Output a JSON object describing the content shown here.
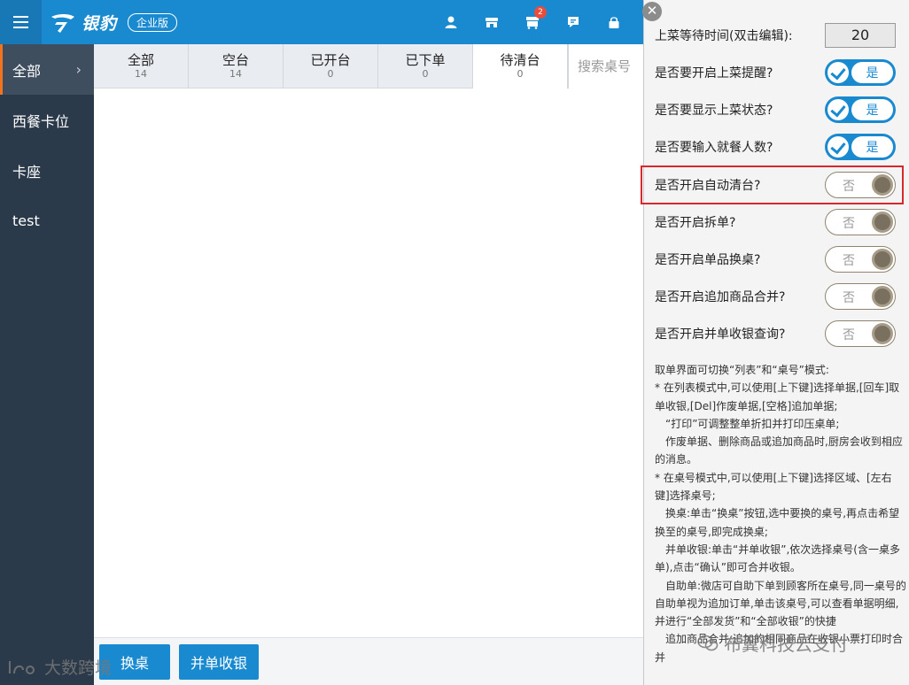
{
  "topbar": {
    "brand": "银豹",
    "edition": "企业版",
    "icons": [
      "user-icon",
      "store-icon",
      "cart-icon",
      "message-icon",
      "lock-icon"
    ],
    "cart_badge": "2"
  },
  "sidebar": {
    "items": [
      {
        "label": "全部"
      },
      {
        "label": "西餐卡位"
      },
      {
        "label": "卡座"
      },
      {
        "label": "test"
      }
    ],
    "active_chevron": "›"
  },
  "tabs": [
    {
      "label": "全部",
      "count": "14"
    },
    {
      "label": "空台",
      "count": "14"
    },
    {
      "label": "已开台",
      "count": "0"
    },
    {
      "label": "已下单",
      "count": "0"
    },
    {
      "label": "待清台",
      "count": "0"
    }
  ],
  "search": {
    "placeholder": "搜索桌号"
  },
  "bottom": {
    "swap_label": "换桌",
    "merge_label": "并单收银"
  },
  "watermarks": {
    "left": "大数跨境",
    "right": "布翼科技云支付"
  },
  "settings": {
    "close": "✕",
    "wait_label": "上菜等待时间(双击编辑):",
    "wait_value": "20",
    "toggles": [
      {
        "label": "是否要开启上菜提醒?",
        "text": "是",
        "state": "on"
      },
      {
        "label": "是否要显示上菜状态?",
        "text": "是",
        "state": "on"
      },
      {
        "label": "是否要输入就餐人数?",
        "text": "是",
        "state": "on"
      },
      {
        "label": "是否开启自动清台?",
        "text": "否",
        "state": "off"
      },
      {
        "label": "是否开启拆单?",
        "text": "否",
        "state": "off"
      },
      {
        "label": "是否开启单品换桌?",
        "text": "否",
        "state": "off"
      },
      {
        "label": "是否开启追加商品合并?",
        "text": "否",
        "state": "off"
      },
      {
        "label": "是否开启并单收银查询?",
        "text": "否",
        "state": "off"
      }
    ],
    "help_lines": [
      "取单界面可切换“列表”和“桌号”模式:",
      "* 在列表模式中,可以使用[上下键]选择单据,[回车]取单收银,[Del]作废单据,[空格]追加单据;",
      "“打印”可调整整单折扣并打印压桌单;",
      "作废单据、删除商品或追加商品时,厨房会收到相应的消息。",
      "* 在桌号模式中,可以使用[上下键]选择区域、[左右键]选择桌号;",
      "换桌:单击“换桌”按钮,选中要换的桌号,再点击希望换至的桌号,即完成换桌;",
      "并单收银:单击“并单收银”,依次选择桌号(含一桌多单),点击“确认”即可合并收银。",
      "自助单:微店可自助下单到顾客所在桌号,同一桌号的自助单视为追加订单,单击该桌号,可以查看单据明细,并进行“全部发货”和“全部收银”的快捷",
      "追加商品合并:追加的相同商品在收银小票打印时合并"
    ]
  },
  "colors": {
    "primary": "#1a8ad0",
    "sidebar_bg": "#2b3a4a",
    "active_accent": "#f0741e",
    "highlight": "#d9272e"
  }
}
